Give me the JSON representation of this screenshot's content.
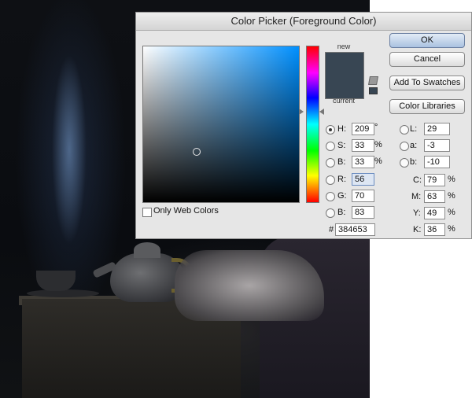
{
  "dialog": {
    "title": "Color Picker (Foreground Color)",
    "new_label": "new",
    "current_label": "current",
    "new_color": "#384653",
    "current_color": "#384653",
    "buttons": {
      "ok": "OK",
      "cancel": "Cancel",
      "add_to_swatches": "Add To Swatches",
      "color_libraries": "Color Libraries"
    },
    "only_web_colors": "Only Web Colors",
    "fields": {
      "H": {
        "label": "H:",
        "value": "209",
        "unit": "°",
        "selected": true
      },
      "S": {
        "label": "S:",
        "value": "33",
        "unit": "%"
      },
      "B": {
        "label": "B:",
        "value": "33",
        "unit": "%"
      },
      "R": {
        "label": "R:",
        "value": "56"
      },
      "G": {
        "label": "G:",
        "value": "70"
      },
      "Bb": {
        "label": "B:",
        "value": "83"
      },
      "L": {
        "label": "L:",
        "value": "29"
      },
      "a": {
        "label": "a:",
        "value": "-3"
      },
      "b": {
        "label": "b:",
        "value": "-10"
      },
      "C": {
        "label": "C:",
        "value": "79",
        "unit": "%"
      },
      "M": {
        "label": "M:",
        "value": "63",
        "unit": "%"
      },
      "Y": {
        "label": "Y:",
        "value": "49",
        "unit": "%"
      },
      "K": {
        "label": "K:",
        "value": "36",
        "unit": "%"
      }
    },
    "hex": {
      "label": "#",
      "value": "384653"
    }
  }
}
